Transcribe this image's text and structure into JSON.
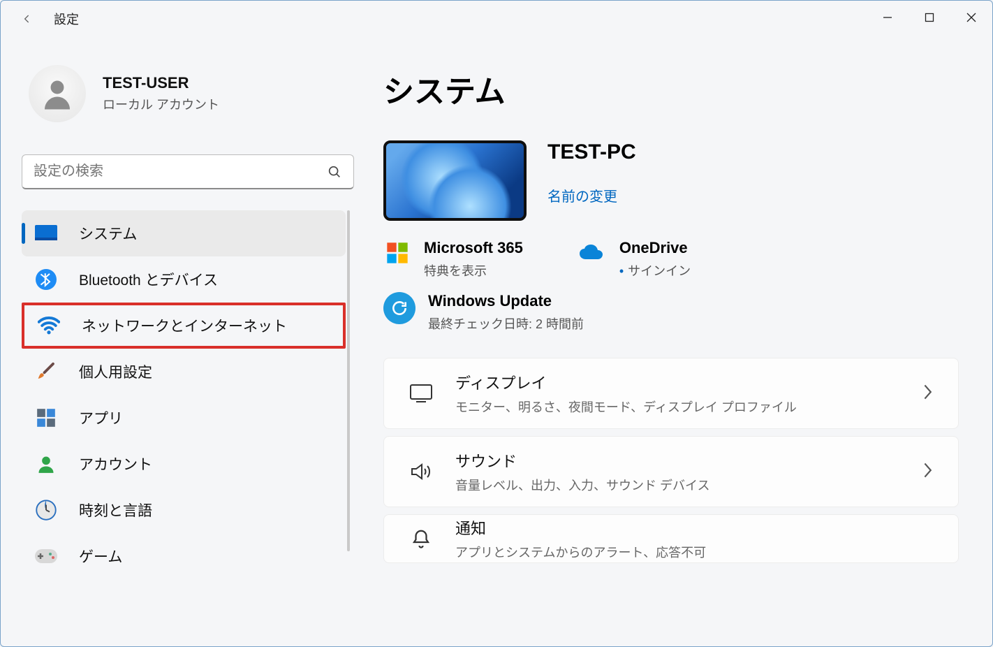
{
  "app_title": "設定",
  "user": {
    "name": "TEST-USER",
    "sub": "ローカル アカウント"
  },
  "search": {
    "placeholder": "設定の検索"
  },
  "sidebar": {
    "items": [
      {
        "label": "システム",
        "icon": "system"
      },
      {
        "label": "Bluetooth とデバイス",
        "icon": "bluetooth"
      },
      {
        "label": "ネットワークとインターネット",
        "icon": "wifi"
      },
      {
        "label": "個人用設定",
        "icon": "brush"
      },
      {
        "label": "アプリ",
        "icon": "apps"
      },
      {
        "label": "アカウント",
        "icon": "account"
      },
      {
        "label": "時刻と言語",
        "icon": "clock"
      },
      {
        "label": "ゲーム",
        "icon": "game"
      }
    ]
  },
  "main": {
    "title": "システム",
    "pc_name": "TEST-PC",
    "rename": "名前の変更",
    "cards": {
      "ms365": {
        "title": "Microsoft 365",
        "sub": "特典を表示"
      },
      "onedrive": {
        "title": "OneDrive",
        "sub": "サインイン"
      }
    },
    "update": {
      "title": "Windows Update",
      "sub": "最終チェック日時: 2 時間前"
    },
    "rows": [
      {
        "title": "ディスプレイ",
        "sub": "モニター、明るさ、夜間モード、ディスプレイ プロファイル",
        "icon": "display"
      },
      {
        "title": "サウンド",
        "sub": "音量レベル、出力、入力、サウンド デバイス",
        "icon": "sound"
      },
      {
        "title": "通知",
        "sub": "アプリとシステムからのアラート、応答不可",
        "icon": "bell"
      }
    ]
  }
}
